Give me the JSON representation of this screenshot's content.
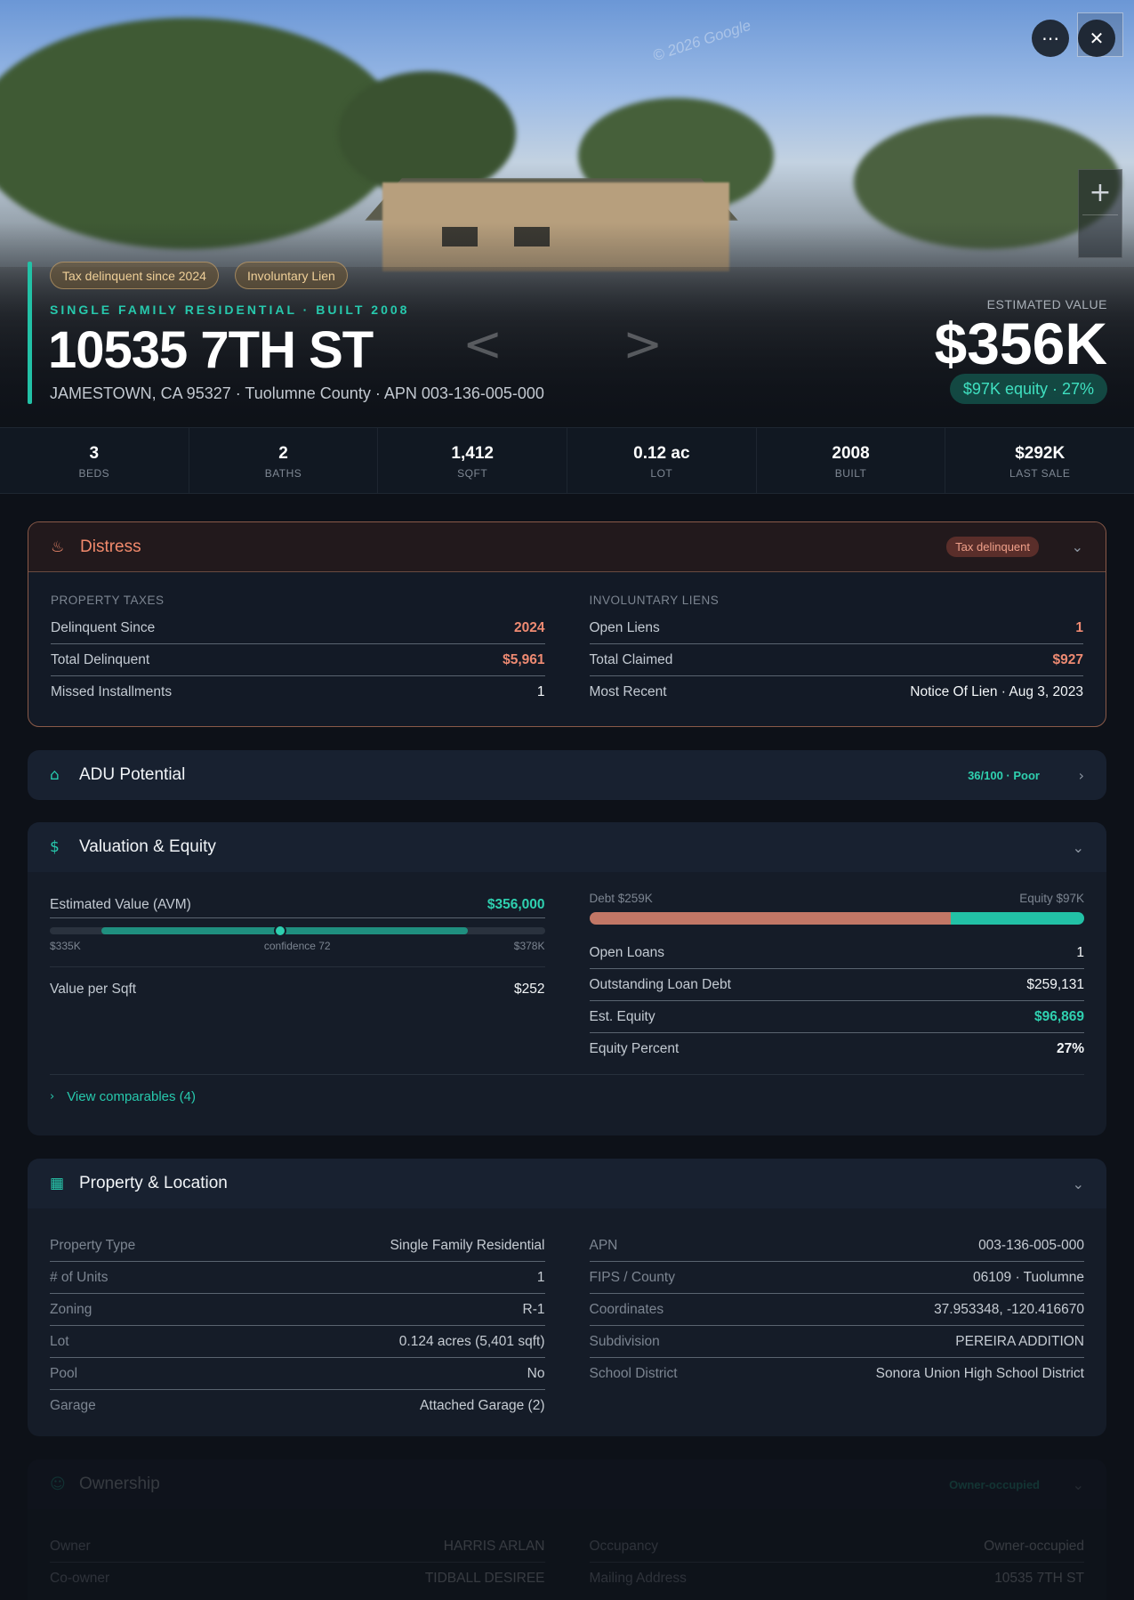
{
  "hero": {
    "watermark": "© 2026 Google",
    "badges": [
      "Tax delinquent since 2024",
      "Involuntary Lien"
    ],
    "kicker": "SINGLE FAMILY RESIDENTIAL · BUILT 2008",
    "address": "10535 7TH ST",
    "subaddress": "JAMESTOWN, CA 95327 · Tuolumne County · APN 003-136-005-000",
    "estimated_label": "ESTIMATED VALUE",
    "estimated_value": "$356K",
    "equity_pill": "$97K equity · 27%",
    "more_icon": "more-horizontal-icon",
    "close_icon": "close-icon",
    "zoom_in": "+",
    "nav_prev": "<",
    "nav_next": ">"
  },
  "stats": [
    {
      "value": "3",
      "label": "BEDS"
    },
    {
      "value": "2",
      "label": "BATHS"
    },
    {
      "value": "1,412",
      "label": "SQFT"
    },
    {
      "value": "0.12 ac",
      "label": "LOT"
    },
    {
      "value": "2008",
      "label": "BUILT"
    },
    {
      "value": "$292K",
      "label": "LAST SALE"
    }
  ],
  "distress": {
    "title": "Distress",
    "badge": "Tax delinquent",
    "taxes": {
      "label": "PROPERTY TAXES",
      "rows": [
        {
          "k": "Delinquent Since",
          "v": "2024"
        },
        {
          "k": "Total Delinquent",
          "v": "$5,961"
        },
        {
          "k": "Missed Installments",
          "v": "1"
        }
      ]
    },
    "liens": {
      "label": "INVOLUNTARY LIENS",
      "rows": [
        {
          "k": "Open Liens",
          "v": "1"
        },
        {
          "k": "Total Claimed",
          "v": "$927"
        },
        {
          "k": "Most Recent",
          "v": "Notice Of Lien · Aug 3, 2023"
        }
      ]
    }
  },
  "adu": {
    "title": "ADU Potential",
    "score": "36/100 · Poor"
  },
  "valuation": {
    "title": "Valuation & Equity",
    "avm_label": "Estimated Value (AVM)",
    "avm_value": "$356,000",
    "avm_low": "$335K",
    "avm_confidence": "confidence 72",
    "avm_high": "$378K",
    "avm_range": {
      "low": 335000,
      "value": 356000,
      "high": 378000
    },
    "value_per_sqft_label": "Value per Sqft",
    "value_per_sqft": "$252",
    "debt_label": "Debt $259K",
    "equity_label": "Equity $97K",
    "debt_fraction": 0.73,
    "loans": [
      {
        "k": "Open Loans",
        "v": "1"
      },
      {
        "k": "Outstanding Loan Debt",
        "v": "$259,131"
      },
      {
        "k": "Est. Equity",
        "v": "$96,869"
      },
      {
        "k": "Equity Percent",
        "v": "27%"
      }
    ],
    "comparables_link": "View comparables (4)"
  },
  "property": {
    "title": "Property & Location",
    "left": [
      {
        "k": "Property Type",
        "v": "Single Family Residential"
      },
      {
        "k": "# of Units",
        "v": "1"
      },
      {
        "k": "Zoning",
        "v": "R-1"
      },
      {
        "k": "Lot",
        "v": "0.124 acres (5,401 sqft)"
      },
      {
        "k": "Pool",
        "v": "No"
      },
      {
        "k": "Garage",
        "v": "Attached Garage (2)"
      }
    ],
    "right": [
      {
        "k": "APN",
        "v": "003-136-005-000"
      },
      {
        "k": "FIPS / County",
        "v": "06109 · Tuolumne"
      },
      {
        "k": "Coordinates",
        "v": "37.953348, -120.416670"
      },
      {
        "k": "Subdivision",
        "v": "PEREIRA ADDITION"
      },
      {
        "k": "School District",
        "v": "Sonora Union High School District"
      }
    ]
  },
  "ownership": {
    "title": "Ownership",
    "badge": "Owner-occupied",
    "left": [
      {
        "k": "Owner",
        "v": "HARRIS ARLAN"
      },
      {
        "k": "Co-owner",
        "v": "TIDBALL DESIREE"
      }
    ],
    "right": [
      {
        "k": "Occupancy",
        "v": "Owner-occupied"
      },
      {
        "k": "Mailing Address",
        "v": "10535 7TH ST"
      }
    ]
  },
  "colors": {
    "accent": "#22c1a6",
    "distress": "#f28a6c",
    "debt": "#c27766"
  }
}
